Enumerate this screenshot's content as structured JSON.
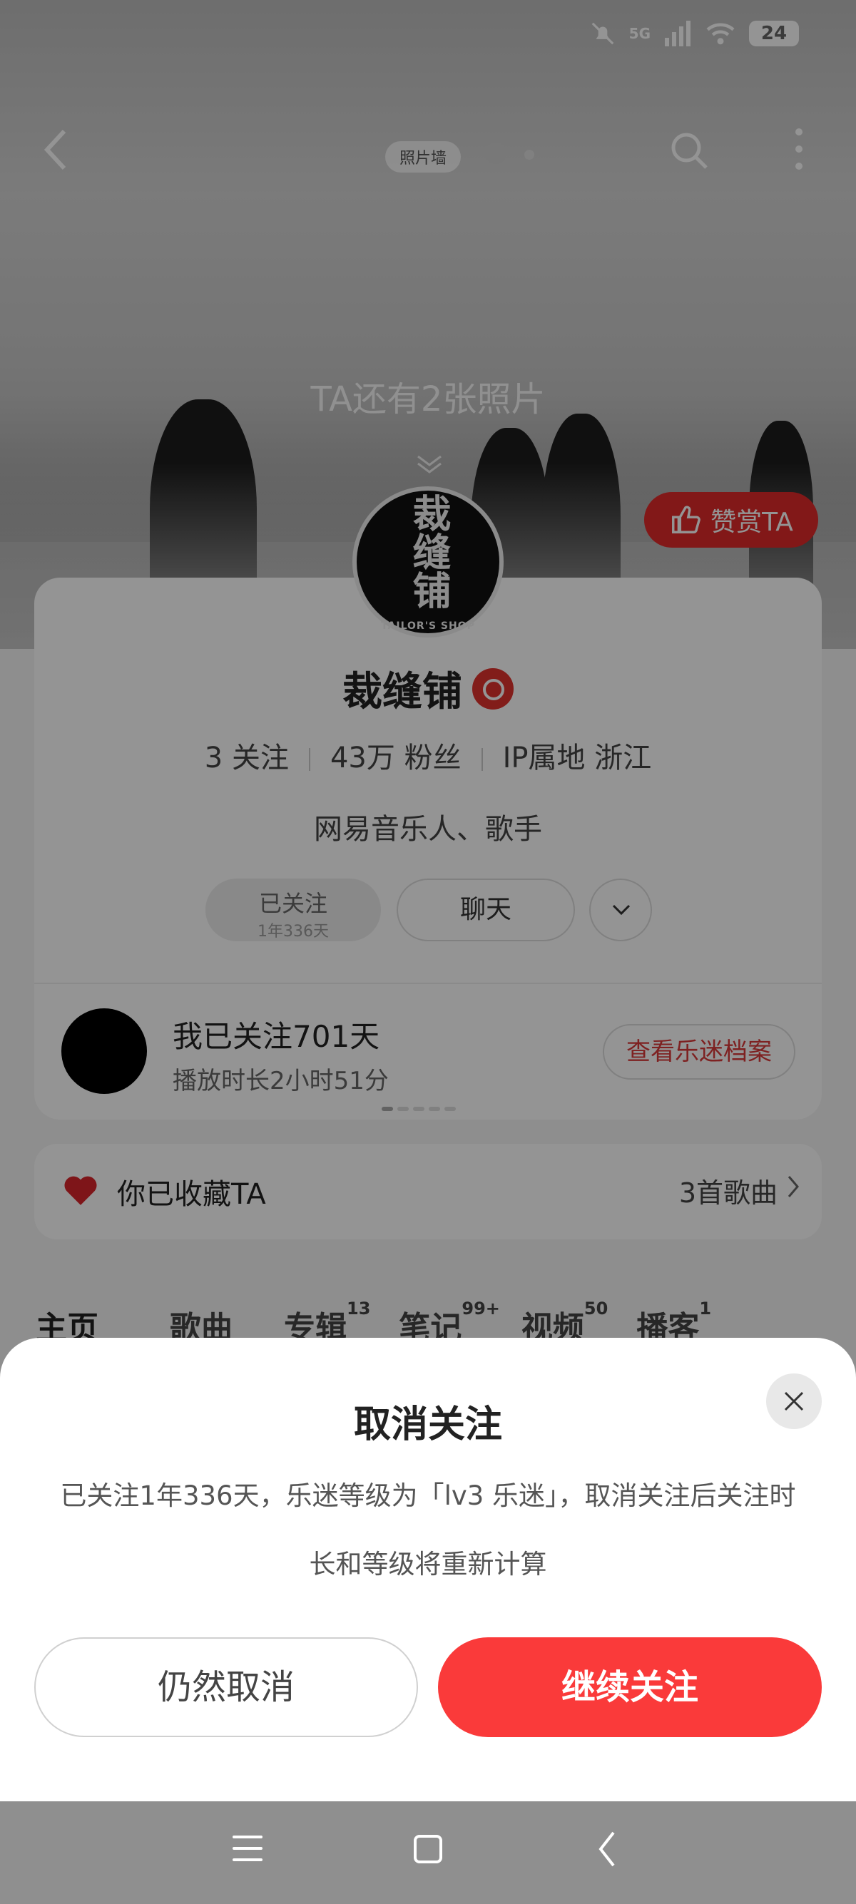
{
  "status_bar": {
    "network": "5G",
    "battery": "24",
    "icons": [
      "mute-bell-icon",
      "signal-icon",
      "wifi-icon",
      "battery-icon"
    ]
  },
  "top_nav": {
    "photo_wall_label": "照片墙",
    "icons": [
      "back-icon",
      "search-icon",
      "more-icon"
    ]
  },
  "hero": {
    "photos_hint": "TA还有2张照片"
  },
  "tip_button": {
    "label": "赞赏TA"
  },
  "profile": {
    "avatar_text": "裁缝铺",
    "avatar_subtext": "TAILOR'S SHOP",
    "name": "裁缝铺",
    "follows": "3 关注",
    "fans": "43万 粉丝",
    "ip_location": "IP属地 浙江",
    "tagline": "网易音乐人、歌手",
    "followed_label": "已关注",
    "followed_duration": "1年336天",
    "chat_label": "聊天"
  },
  "fan_card": {
    "title": "我已关注701天",
    "subtitle": "播放时长2小时51分",
    "button_label": "查看乐迷档案"
  },
  "favorites": {
    "text": "你已收藏TA",
    "count": "3首歌曲"
  },
  "tabs": [
    {
      "label": "主页",
      "badge": ""
    },
    {
      "label": "歌曲",
      "badge": ""
    },
    {
      "label": "专辑",
      "badge": "13"
    },
    {
      "label": "笔记",
      "badge": "99+"
    },
    {
      "label": "视频",
      "badge": "50"
    },
    {
      "label": "播客",
      "badge": "1"
    }
  ],
  "dialog": {
    "title": "取消关注",
    "message_line1": "已关注1年336天，乐迷等级为「lv3 乐迷」，取消关注后关注时",
    "message_line2": "长和等级将重新计算",
    "cancel_label": "仍然取消",
    "keep_label": "继续关注"
  },
  "colors": {
    "accent": "#fa3a3a",
    "tip": "#e02a2a",
    "link": "#d93a3a"
  }
}
